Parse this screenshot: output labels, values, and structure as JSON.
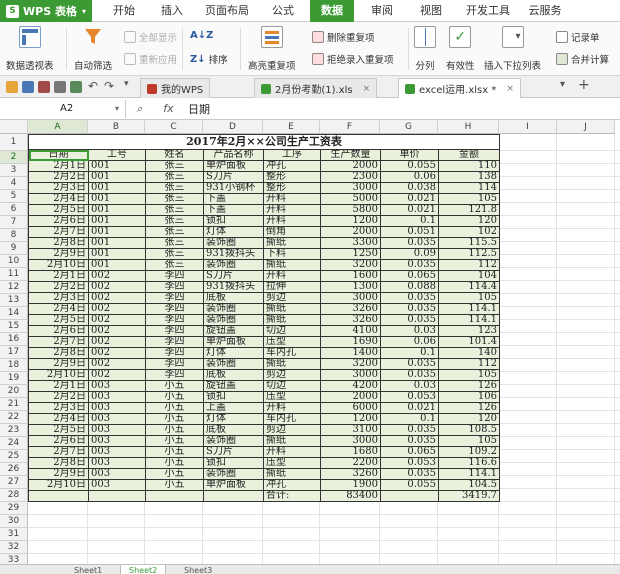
{
  "app": {
    "name": "WPS 表格",
    "logo_letter": "S"
  },
  "menu": [
    "开始",
    "插入",
    "页面布局",
    "公式",
    "数据",
    "审阅",
    "视图",
    "开发工具",
    "云服务"
  ],
  "active_menu": 4,
  "ribbon": {
    "pivot": "数据透视表",
    "autofilter": "自动筛选",
    "show_all": "全部显示",
    "reapply": "重新应用",
    "sort": "排序",
    "highlight_dup": "高亮重复项",
    "delete_dup": "删除重复项",
    "reject_dup": "拒绝录入重复项",
    "split": "分列",
    "validity": "有效性",
    "insert_dropdown": "插入下拉列表",
    "record": "记录单",
    "merge_calc": "合并计算"
  },
  "doc_tabs": [
    {
      "label": "我的WPS",
      "closable": false
    },
    {
      "label": "2月份考勤(1).xls",
      "closable": true
    },
    {
      "label": "excel运用.xlsx *",
      "closable": true
    }
  ],
  "active_doc_tab": 2,
  "formula_bar": {
    "cell_ref": "A2",
    "fx": "fx",
    "value": "日期"
  },
  "columns": [
    "A",
    "B",
    "C",
    "D",
    "E",
    "F",
    "G",
    "H",
    "I",
    "J"
  ],
  "selected_column": "A",
  "selected_row": 2,
  "sheet": {
    "title": "2017年2月××公司生产工资表",
    "headers": [
      "日期",
      "工号",
      "姓名",
      "产品名称",
      "工序",
      "生产数量",
      "单价",
      "金额"
    ],
    "rows": [
      [
        "2月1日",
        "001",
        "张三",
        "单炉面板",
        "冲孔",
        "2000",
        "0.055",
        "110"
      ],
      [
        "2月2日",
        "001",
        "张三",
        "S刀片",
        "整形",
        "2300",
        "0.06",
        "138"
      ],
      [
        "2月3日",
        "001",
        "张三",
        "931小钢杯",
        "整形",
        "3000",
        "0.038",
        "114"
      ],
      [
        "2月4日",
        "001",
        "张三",
        "下盖",
        "开料",
        "5000",
        "0.021",
        "105"
      ],
      [
        "2月5日",
        "001",
        "张三",
        "下盖",
        "开料",
        "5800",
        "0.021",
        "121.8"
      ],
      [
        "2月6日",
        "001",
        "张三",
        "锁扣",
        "开料",
        "1200",
        "0.1",
        "120"
      ],
      [
        "2月7日",
        "001",
        "张三",
        "灯体",
        "倒角",
        "2000",
        "0.051",
        "102"
      ],
      [
        "2月8日",
        "001",
        "张三",
        "装饰圈",
        "撕纸",
        "3300",
        "0.035",
        "115.5"
      ],
      [
        "2月9日",
        "001",
        "张三",
        "931拨抖头",
        "下料",
        "1250",
        "0.09",
        "112.5"
      ],
      [
        "2月10日",
        "001",
        "张三",
        "装饰圈",
        "撕纸",
        "3200",
        "0.035",
        "112"
      ],
      [
        "2月1日",
        "002",
        "李四",
        "S刀片",
        "开料",
        "1600",
        "0.065",
        "104"
      ],
      [
        "2月2日",
        "002",
        "李四",
        "931拨抖头",
        "拉伸",
        "1300",
        "0.088",
        "114.4"
      ],
      [
        "2月3日",
        "002",
        "李四",
        "底板",
        "剪边",
        "3000",
        "0.035",
        "105"
      ],
      [
        "2月4日",
        "002",
        "李四",
        "装饰圈",
        "撕纸",
        "3260",
        "0.035",
        "114.1"
      ],
      [
        "2月5日",
        "002",
        "李四",
        "装饰圈",
        "撕纸",
        "3260",
        "0.035",
        "114.1"
      ],
      [
        "2月6日",
        "002",
        "李四",
        "旋钮盖",
        "切边",
        "4100",
        "0.03",
        "123"
      ],
      [
        "2月7日",
        "002",
        "李四",
        "单炉面板",
        "压型",
        "1690",
        "0.06",
        "101.4"
      ],
      [
        "2月8日",
        "002",
        "李四",
        "灯体",
        "车内孔",
        "1400",
        "0.1",
        "140"
      ],
      [
        "2月9日",
        "002",
        "李四",
        "装饰圈",
        "撕纸",
        "3200",
        "0.035",
        "112"
      ],
      [
        "2月10日",
        "002",
        "李四",
        "底板",
        "剪边",
        "3000",
        "0.035",
        "105"
      ],
      [
        "2月1日",
        "003",
        "小五",
        "旋钮盖",
        "切边",
        "4200",
        "0.03",
        "126"
      ],
      [
        "2月2日",
        "003",
        "小五",
        "锁扣",
        "压型",
        "2000",
        "0.053",
        "106"
      ],
      [
        "2月3日",
        "003",
        "小五",
        "上盖",
        "开料",
        "6000",
        "0.021",
        "126"
      ],
      [
        "2月4日",
        "003",
        "小五",
        "灯体",
        "车内孔",
        "1200",
        "0.1",
        "120"
      ],
      [
        "2月5日",
        "003",
        "小五",
        "底板",
        "剪边",
        "3100",
        "0.035",
        "108.5"
      ],
      [
        "2月6日",
        "003",
        "小五",
        "装饰圈",
        "撕纸",
        "3000",
        "0.035",
        "105"
      ],
      [
        "2月7日",
        "003",
        "小五",
        "S刀片",
        "开料",
        "1680",
        "0.065",
        "109.2"
      ],
      [
        "2月8日",
        "003",
        "小五",
        "锁扣",
        "压型",
        "2200",
        "0.053",
        "116.6"
      ],
      [
        "2月9日",
        "003",
        "小五",
        "装饰圈",
        "撕纸",
        "3260",
        "0.035",
        "114.1"
      ],
      [
        "2月10日",
        "003",
        "小五",
        "单炉面板",
        "冲孔",
        "1900",
        "0.055",
        "104.5"
      ]
    ],
    "total": {
      "label": "合计:",
      "quantity": "83400",
      "amount": "3419.7"
    }
  },
  "sheet_tabs": [
    "Sheet1",
    "Sheet2",
    "Sheet3"
  ],
  "active_sheet_tab": 1,
  "colors": {
    "accent": "#3c9a35",
    "cell_fill": "#e9f1dc"
  }
}
